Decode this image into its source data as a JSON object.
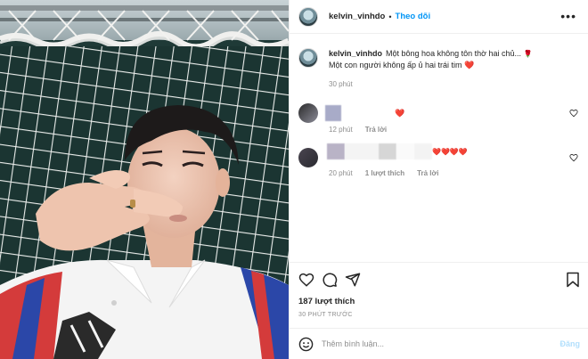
{
  "post": {
    "username": "kelvin_vinhdo",
    "follow_label": "Theo dõi",
    "separator": "•",
    "more_icon": "more-dots-icon"
  },
  "caption": {
    "username": "kelvin_vinhdo",
    "line1": "Một bông hoa không tôn thờ hai chủ...",
    "line1_emoji": "🌹",
    "line2": "Một con người không ấp ủ hai trái tim",
    "line2_emoji": "❤️",
    "time": "30 phút"
  },
  "comments": [
    {
      "text": "❤️",
      "time": "12 phút",
      "reply_label": "Trả lời"
    },
    {
      "text": "❤️❤️❤️❤️",
      "time": "20 phút",
      "likes_label": "1 lượt thích",
      "reply_label": "Trả lời"
    }
  ],
  "actions": {
    "like_icon": "heart-icon",
    "comment_icon": "comment-icon",
    "share_icon": "share-icon",
    "save_icon": "bookmark-icon",
    "likes_count": "187 lượt thích",
    "post_time": "30 PHÚT TRƯỚC"
  },
  "add_comment": {
    "emoji_icon": "emoji-icon",
    "placeholder": "Thêm bình luận...",
    "post_label": "Đăng"
  },
  "colors": {
    "follow": "#0095f6",
    "meta": "#8e8e8e",
    "heart": "#e0245e",
    "post_disabled": "#b2dffc"
  }
}
